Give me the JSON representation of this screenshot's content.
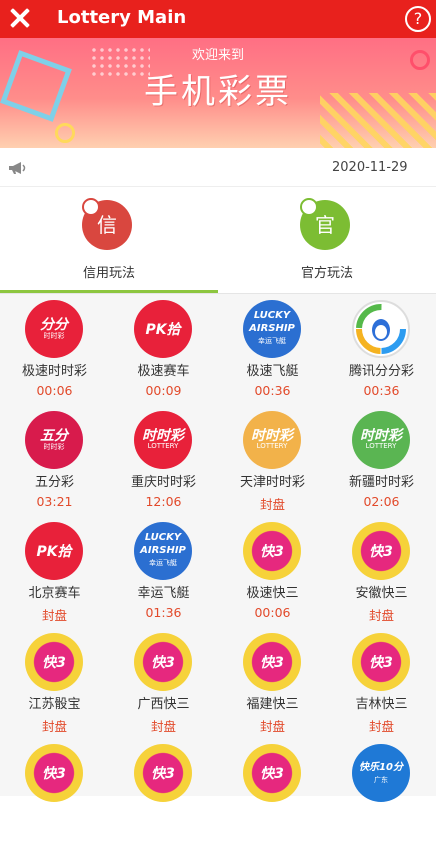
{
  "header": {
    "title": "Lottery Main",
    "close_icon": "close-icon",
    "help_icon": "question-mark",
    "help_glyph": "?"
  },
  "banner": {
    "welcome": "欢迎来到",
    "main_text": "手机彩票"
  },
  "notice": {
    "icon": "megaphone-icon",
    "date": "2020-11-29"
  },
  "modes": [
    {
      "label": "信用玩法",
      "icon_text": "信",
      "color": "#d9473f"
    },
    {
      "label": "官方玩法",
      "icon_text": "官",
      "color": "#7cbd33"
    }
  ],
  "games": [
    {
      "name": "极速时时彩",
      "time": "00:06",
      "logo": "分分\n时时彩",
      "style": "t-red"
    },
    {
      "name": "极速赛车",
      "time": "00:09",
      "logo": "PK拾",
      "style": "t-pk"
    },
    {
      "name": "极速飞艇",
      "time": "00:36",
      "logo": "LUCKY\nAIRSHIP\n幸运飞艇",
      "style": "t-blue"
    },
    {
      "name": "腾讯分分彩",
      "time": "00:36",
      "logo": "",
      "style": "t-qq"
    },
    {
      "name": "五分彩",
      "time": "03:21",
      "logo": "五分\n时时彩",
      "style": "t-five"
    },
    {
      "name": "重庆时时彩",
      "time": "12:06",
      "logo": "时时彩\nLOTTERY",
      "style": "t-ssc"
    },
    {
      "name": "天津时时彩",
      "time": "封盘",
      "logo": "时时彩\nLOTTERY",
      "style": "t-tj"
    },
    {
      "name": "新疆时时彩",
      "time": "02:06",
      "logo": "时时彩\nLOTTERY",
      "style": "t-xj"
    },
    {
      "name": "北京赛车",
      "time": "封盘",
      "logo": "PK拾",
      "style": "t-pk"
    },
    {
      "name": "幸运飞艇",
      "time": "01:36",
      "logo": "LUCKY\nAIRSHIP\n幸运飞艇",
      "style": "t-blue"
    },
    {
      "name": "极速快三",
      "time": "00:06",
      "logo": "快3",
      "style": "t-k3"
    },
    {
      "name": "安徽快三",
      "time": "封盘",
      "logo": "快3",
      "style": "t-k3"
    },
    {
      "name": "江苏骰宝",
      "time": "封盘",
      "logo": "快3",
      "style": "t-k3"
    },
    {
      "name": "广西快三",
      "time": "封盘",
      "logo": "快3",
      "style": "t-k3"
    },
    {
      "name": "福建快三",
      "time": "封盘",
      "logo": "快3",
      "style": "t-k3"
    },
    {
      "name": "吉林快三",
      "time": "封盘",
      "logo": "快3",
      "style": "t-k3"
    },
    {
      "name": "",
      "time": "",
      "logo": "快3",
      "style": "t-k3"
    },
    {
      "name": "",
      "time": "",
      "logo": "快3",
      "style": "t-k3"
    },
    {
      "name": "",
      "time": "",
      "logo": "快3",
      "style": "t-k3"
    },
    {
      "name": "",
      "time": "",
      "logo": "快乐10分\n广东",
      "style": "t-blue10"
    }
  ]
}
